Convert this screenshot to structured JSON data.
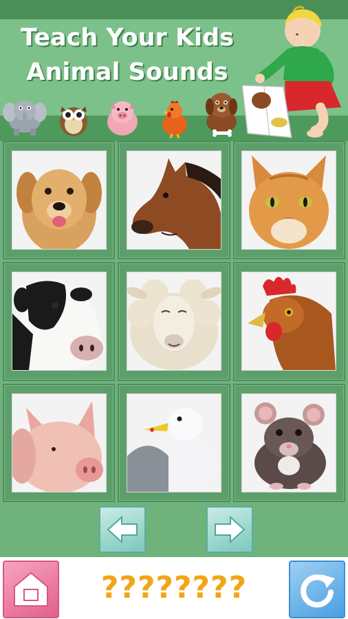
{
  "header": {
    "title_line1": "Teach Your Kids",
    "title_line2": "Animal Sounds",
    "mini_animals": [
      "elephant-icon",
      "owl-icon",
      "pig-icon",
      "chicken-icon",
      "dog-icon"
    ]
  },
  "grid": {
    "tiles": [
      {
        "animal": "dog"
      },
      {
        "animal": "horse"
      },
      {
        "animal": "cat"
      },
      {
        "animal": "cow"
      },
      {
        "animal": "sheep"
      },
      {
        "animal": "chicken"
      },
      {
        "animal": "pig"
      },
      {
        "animal": "seagull"
      },
      {
        "animal": "rat"
      }
    ]
  },
  "navigation": {
    "prev_icon": "arrow-left-icon",
    "next_icon": "arrow-right-icon"
  },
  "bottom_bar": {
    "answer_text": "????????",
    "home_icon": "home-icon",
    "replay_icon": "replay-icon"
  },
  "colors": {
    "background": "#6fb27c",
    "header": "#7cc08a",
    "answer": "#f2a516",
    "home_button": "#e2608a",
    "replay_button": "#4a9ee0",
    "nav_button": "#7cc8bc"
  }
}
